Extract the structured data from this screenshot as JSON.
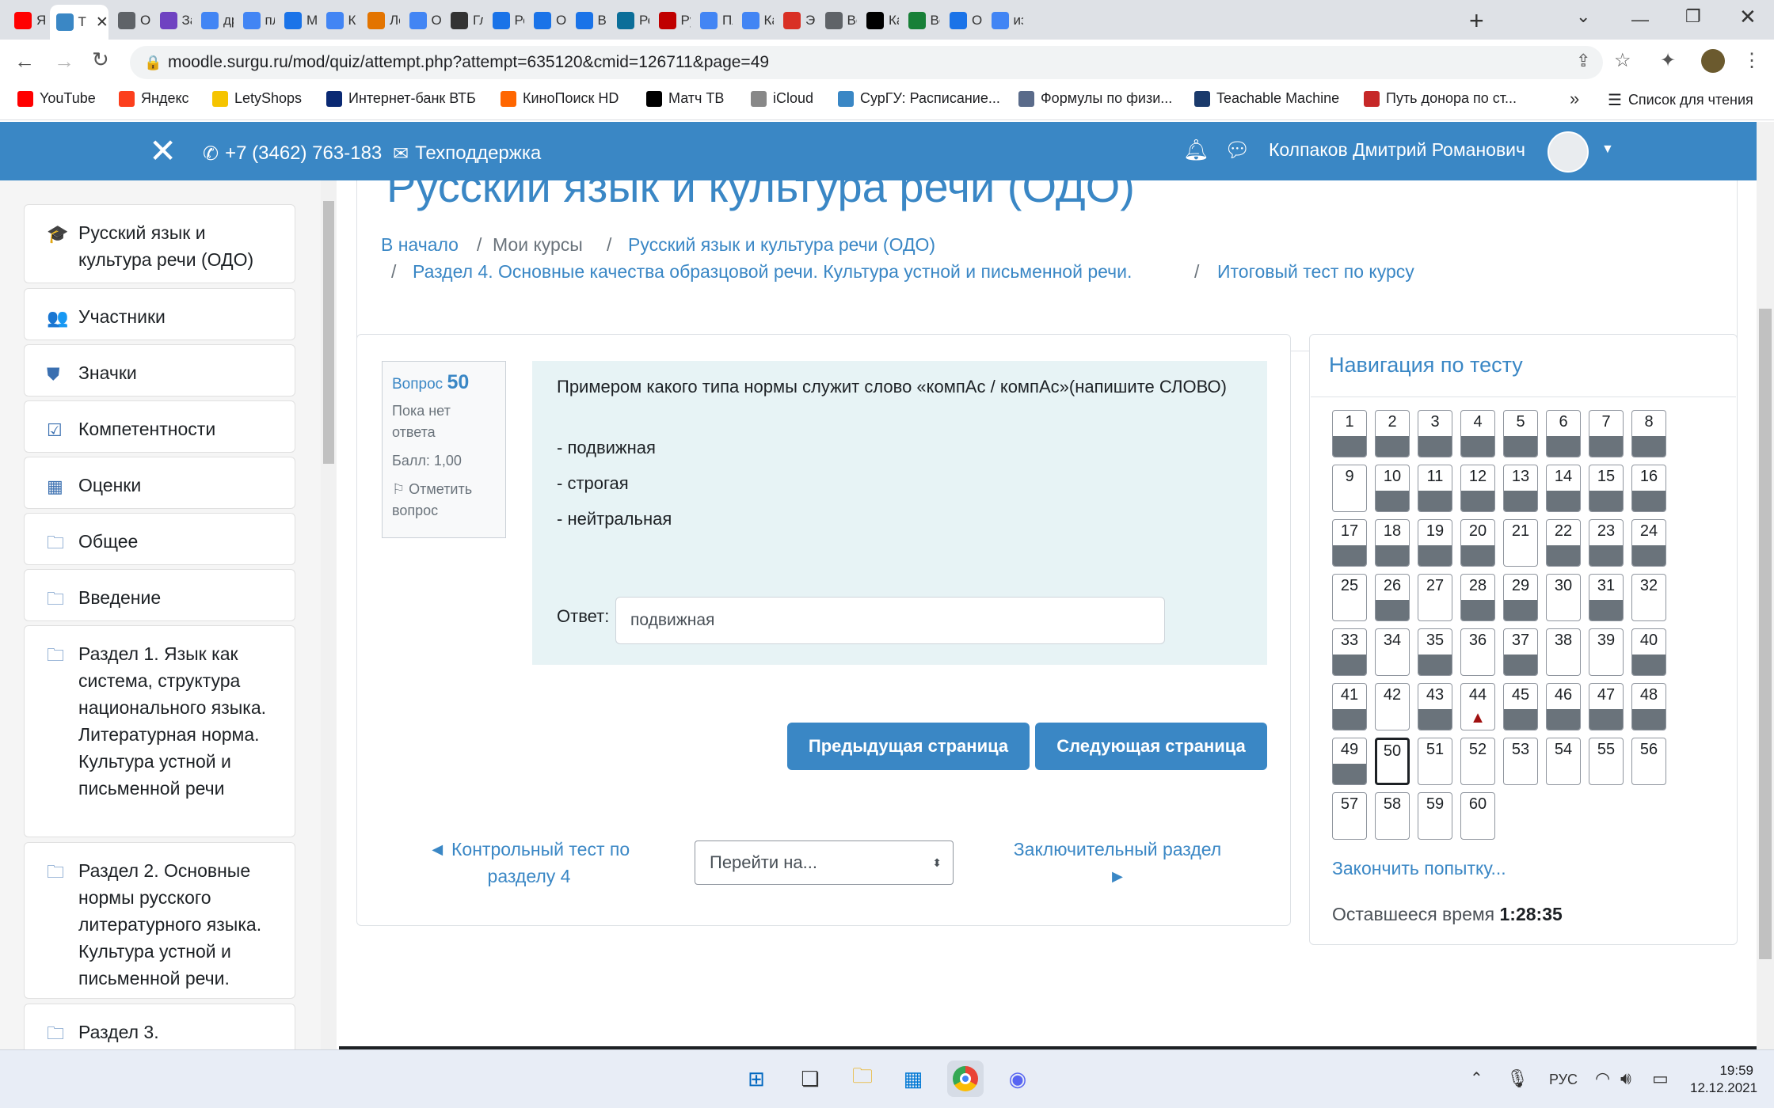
{
  "browser": {
    "tabs": [
      {
        "label": "Я",
        "icon": "youtube-icon",
        "color": "#ff0000"
      },
      {
        "label": "Т",
        "icon": "moodle-icon",
        "color": "#3a87c5",
        "active": true
      },
      {
        "label": "Ос",
        "icon": "globe-icon",
        "color": "#5f6368"
      },
      {
        "label": "За",
        "icon": "question-icon",
        "color": "#6f42c1"
      },
      {
        "label": "др",
        "icon": "google-icon",
        "color": "#4285f4"
      },
      {
        "label": "пл",
        "icon": "google-icon",
        "color": "#4285f4"
      },
      {
        "label": "М",
        "icon": "chat-icon",
        "color": "#1a73e8"
      },
      {
        "label": "К",
        "icon": "google-icon",
        "color": "#4285f4"
      },
      {
        "label": "Ле",
        "icon": "compass-icon",
        "color": "#e37400"
      },
      {
        "label": "От",
        "icon": "google-icon",
        "color": "#4285f4"
      },
      {
        "label": "Гл",
        "icon": "person-icon",
        "color": "#333333"
      },
      {
        "label": "Ре",
        "icon": "question-icon",
        "color": "#1a73e8"
      },
      {
        "label": "От",
        "icon": "bulb-icon",
        "color": "#1a73e8"
      },
      {
        "label": "Вн",
        "icon": "book-icon",
        "color": "#1a73e8"
      },
      {
        "label": "Ре",
        "icon": "s-icon",
        "color": "#0b6e99"
      },
      {
        "label": "Ру",
        "icon": "ball-icon",
        "color": "#c00000"
      },
      {
        "label": "Пл",
        "icon": "google-icon",
        "color": "#4285f4"
      },
      {
        "label": "Ка",
        "icon": "google-icon",
        "color": "#4285f4"
      },
      {
        "label": "Эс",
        "icon": "case-icon",
        "color": "#d93025"
      },
      {
        "label": "Ве",
        "icon": "globe-icon",
        "color": "#5f6368"
      },
      {
        "label": "Ка",
        "icon": "m-icon",
        "color": "#000000"
      },
      {
        "label": "Ве",
        "icon": "check-icon",
        "color": "#188038"
      },
      {
        "label": "От",
        "icon": "question-icon",
        "color": "#1a73e8"
      },
      {
        "label": "из",
        "icon": "google-icon",
        "color": "#4285f4"
      }
    ],
    "new_tab": "+",
    "url": "moodle.surgu.ru/mod/quiz/attempt.php?attempt=635120&cmid=126711&page=49",
    "bookmarks": [
      {
        "label": "YouTube",
        "color": "#ff0000"
      },
      {
        "label": "Яндекс",
        "color": "#fc3f1d"
      },
      {
        "label": "LetyShops",
        "color": "#f5c400"
      },
      {
        "label": "Интернет-банк ВТБ",
        "color": "#0a2973"
      },
      {
        "label": "КиноПоиск HD",
        "color": "#ff6600"
      },
      {
        "label": "Матч ТВ",
        "color": "#000000"
      },
      {
        "label": "iCloud",
        "color": "#888888"
      },
      {
        "label": "СурГУ: Расписание...",
        "color": "#3a87c5"
      },
      {
        "label": "Формулы по физи...",
        "color": "#5a6b8a"
      },
      {
        "label": "Teachable Machine",
        "color": "#1a3a6b"
      },
      {
        "label": "Путь донора по ст...",
        "color": "#c62828"
      }
    ],
    "more_bookmarks": "»",
    "reading_list": "Список для чтения"
  },
  "header": {
    "phone": "+7 (3462) 763-183",
    "support": "Техподдержка",
    "user": "Колпаков Дмитрий Романович"
  },
  "sidebar": {
    "items": [
      {
        "label": "Русский язык и культура речи (ОДО)",
        "icon": "graduation-cap-icon",
        "glyph": "🎓"
      },
      {
        "label": "Участники",
        "icon": "users-icon",
        "glyph": "👥"
      },
      {
        "label": "Значки",
        "icon": "shield-icon",
        "glyph": "⛊"
      },
      {
        "label": "Компетентности",
        "icon": "checkbox-icon",
        "glyph": "☑"
      },
      {
        "label": "Оценки",
        "icon": "table-icon",
        "glyph": "▦"
      },
      {
        "label": "Общее",
        "icon": "folder-icon",
        "glyph": "🗀"
      },
      {
        "label": "Введение",
        "icon": "folder-icon",
        "glyph": "🗀"
      },
      {
        "label": "Раздел 1. Язык как система, структура национального языка. Литературная норма. Культура устной и письменной речи",
        "icon": "folder-icon",
        "glyph": "🗀"
      },
      {
        "label": "Раздел 2. Основные нормы русского литературного языка. Культура устной и письменной речи.",
        "icon": "folder-icon",
        "glyph": "🗀"
      },
      {
        "label": "Раздел 3.",
        "icon": "folder-icon",
        "glyph": "🗀"
      }
    ]
  },
  "course": {
    "title": "Русский язык и культура речи (ОДО)",
    "breadcrumb": {
      "home": "В начало",
      "my_courses": "Мои курсы",
      "course": "Русский язык и культура речи (ОДО)",
      "section": "Раздел 4. Основные качества образцовой речи. Культура устной и письменной речи.",
      "quiz": "Итоговый тест по курсу",
      "sep": "/"
    }
  },
  "question": {
    "label": "Вопрос",
    "number": "50",
    "status": "Пока нет ответа",
    "mark": "Балл: 1,00",
    "flag": "Отметить вопрос",
    "text": "Примером какого типа нормы служит слово «компАс / компАс»(напишите СЛОВО)",
    "options": [
      "- подвижная",
      "- строгая",
      "- нейтральная"
    ],
    "answer_label": "Ответ:",
    "answer_value": "подвижная"
  },
  "buttons": {
    "prev": "Предыдущая страница",
    "next": "Следующая страница"
  },
  "activity_nav": {
    "prev": "◄ Контрольный тест по разделу 4",
    "jump": "Перейти на...",
    "next": "Заключительный раздел ►"
  },
  "quiz_nav": {
    "title": "Навигация по тесту",
    "answered": [
      1,
      2,
      3,
      4,
      5,
      6,
      7,
      8,
      10,
      11,
      12,
      13,
      14,
      15,
      16,
      17,
      18,
      19,
      20,
      22,
      23,
      24,
      26,
      28,
      29,
      31,
      33,
      35,
      37,
      40,
      41,
      43,
      45,
      46,
      47,
      48,
      49
    ],
    "flagged": [
      44
    ],
    "current": 50,
    "total": 60,
    "finish": "Закончить попытку...",
    "time_label": "Оставшееся время",
    "time_value": "1:28:35"
  },
  "taskbar": {
    "lang": "РУС",
    "time": "19:59",
    "date": "12.12.2021"
  }
}
